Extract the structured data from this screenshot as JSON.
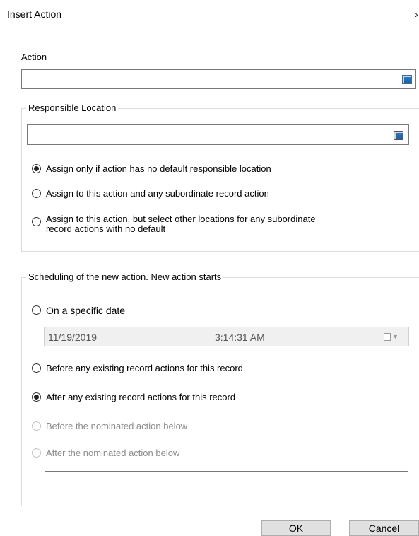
{
  "dialog": {
    "title": "Insert Action",
    "close_glyph": "›"
  },
  "action": {
    "label": "Action",
    "value": "",
    "browse_icon": "folder-browse-icon"
  },
  "responsible_location": {
    "legend": "Responsible Location",
    "value": "",
    "browse_icon": "folder-browse-icon",
    "options": [
      {
        "label": "Assign only if action has no default responsible location",
        "selected": true
      },
      {
        "label": "Assign to this action and any subordinate record action",
        "selected": false
      },
      {
        "label_line1": "Assign to this action, but select other locations for any subordinate",
        "label_line2": "record actions with no default",
        "selected": false
      }
    ]
  },
  "scheduling": {
    "legend": "Scheduling of the new action. New action starts",
    "options": [
      {
        "label": "On a specific date",
        "selected": false,
        "enabled": true
      },
      {
        "label": "Before any existing record actions for this record",
        "selected": false,
        "enabled": true
      },
      {
        "label": "After any existing record actions for this record",
        "selected": true,
        "enabled": true
      },
      {
        "label": "Before the nominated action below",
        "selected": false,
        "enabled": false
      },
      {
        "label": "After the nominated action below",
        "selected": false,
        "enabled": false
      }
    ],
    "date": "11/19/2019",
    "time": "3:14:31 AM",
    "nominated_action_value": ""
  },
  "buttons": {
    "ok": "OK",
    "cancel": "Cancel"
  }
}
